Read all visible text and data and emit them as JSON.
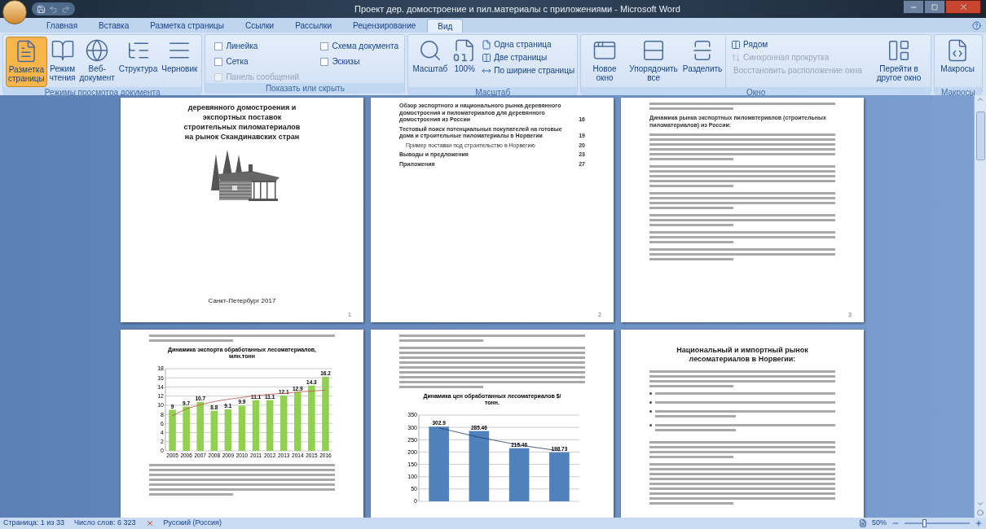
{
  "window": {
    "title": "Проект дер. домостроение и пил.материалы с приложениями - Microsoft Word"
  },
  "tabs": [
    {
      "label": "Главная",
      "selected": false
    },
    {
      "label": "Вставка",
      "selected": false
    },
    {
      "label": "Разметка страницы",
      "selected": false
    },
    {
      "label": "Ссылки",
      "selected": false
    },
    {
      "label": "Рассылки",
      "selected": false
    },
    {
      "label": "Рецензирование",
      "selected": false
    },
    {
      "label": "Вид",
      "selected": true
    }
  ],
  "ribbon": {
    "groups": [
      {
        "label": "Режимы просмотра документа",
        "kind": "views",
        "items": [
          {
            "label": "Разметка страницы",
            "selected": true
          },
          {
            "label": "Режим чтения",
            "selected": false
          },
          {
            "label": "Веб-документ",
            "selected": false
          },
          {
            "label": "Структура",
            "selected": false
          },
          {
            "label": "Черновик",
            "selected": false
          }
        ]
      },
      {
        "label": "Показать или скрыть",
        "kind": "checks",
        "items": [
          {
            "label": "Линейка",
            "checked": false,
            "disabled": false
          },
          {
            "label": "Сетка",
            "checked": false,
            "disabled": false
          },
          {
            "label": "Панель сообщений",
            "checked": false,
            "disabled": true
          },
          {
            "label": "Схема документа",
            "checked": false,
            "disabled": false
          },
          {
            "label": "Эскизы",
            "checked": false,
            "disabled": false
          }
        ]
      },
      {
        "label": "Масштаб",
        "kind": "zoom",
        "items": [
          {
            "label": "Масштаб",
            "disabled": false
          },
          {
            "label": "100%",
            "disabled": false
          },
          {
            "label": "Одна страница",
            "disabled": false
          },
          {
            "label": "Две страницы",
            "disabled": false
          },
          {
            "label": "По ширине страницы",
            "disabled": false
          }
        ]
      },
      {
        "label": "Окно",
        "kind": "window",
        "items": [
          {
            "label": "Новое окно",
            "disabled": false
          },
          {
            "label": "Упорядочить все",
            "disabled": false
          },
          {
            "label": "Разделить",
            "disabled": false
          },
          {
            "label": "Рядом",
            "disabled": false
          },
          {
            "label": "Синхронная прокрутка",
            "disabled": true
          },
          {
            "label": "Восстановить расположение окна",
            "disabled": true
          },
          {
            "label": "Перейти в другое окно",
            "disabled": false
          }
        ]
      },
      {
        "label": "Макросы",
        "kind": "macros",
        "items": [
          {
            "label": "Макросы",
            "disabled": false
          }
        ]
      }
    ]
  },
  "pages": [
    {
      "kind": "title",
      "title": "деревянного домостроения и экспортных поставок строительных пиломатериалов на рынок Скандинавских стран",
      "city": "Санкт-Петербург 2017",
      "number": "1"
    },
    {
      "kind": "toc",
      "entries": [
        {
          "text": "Обзор экспортного и национального рынка деревянного домостроения и пиломатериалов для деревянного домостроения из России",
          "page": "16",
          "indented": false
        },
        {
          "text": "Тестовый поиск потенциальных покупателей на готовые дома и строительные пиломатериалы в Норвегии",
          "page": "19",
          "indented": false
        },
        {
          "text": "Пример поставки под строительство в Норвегию",
          "page": "20",
          "indented": true
        },
        {
          "text": "Выводы и предложения",
          "page": "23",
          "indented": false
        },
        {
          "text": "Приложения",
          "page": "27",
          "indented": false
        }
      ],
      "number": "2"
    },
    {
      "kind": "text",
      "blocks": [
        {
          "kind": "text_lines"
        },
        {
          "kind": "heading",
          "text": "Динамика рынка экспортных пиломатериалов (строительных пиломатериалов) из России:"
        },
        {
          "kind": "text_lines"
        },
        {
          "kind": "text_lines"
        },
        {
          "kind": "text_lines"
        },
        {
          "kind": "text_lines"
        },
        {
          "kind": "text_lines"
        },
        {
          "kind": "text_lines"
        }
      ],
      "number": "3"
    },
    {
      "kind": "text",
      "blocks": [
        {
          "kind": "text_lines"
        },
        {
          "kind": "chart",
          "chart_data": {
            "type": "bar",
            "title": "Динамика экспорта обработанных лесоматериалов, млн.тонн",
            "categories": [
              "2005",
              "2006",
              "2007",
              "2008",
              "2009",
              "2010",
              "2011",
              "2012",
              "2013",
              "2014",
              "2015",
              "2016"
            ],
            "series": [
              {
                "color": "#92d050",
                "values": [
                  9,
                  9.7,
                  10.7,
                  8.8,
                  9.1,
                  9.9,
                  11.1,
                  11.1,
                  12.1,
                  12.9,
                  14.3,
                  16.2
                ]
              },
              {
                "type": "line",
                "color": "#c0504d",
                "values": [
                  7.7,
                  9.2,
                  10.1,
                  10.8,
                  11.3,
                  11.7,
                  12.1,
                  12.4,
                  12.6,
                  12.9,
                  13.1,
                  13.3
                ]
              }
            ],
            "ylim": [
              0,
              18
            ],
            "yticks": [
              0,
              2,
              4,
              6,
              8,
              10,
              12,
              14,
              16,
              18
            ],
            "grid": true,
            "value_labels": [
              [
                "9",
                "9.7",
                "10.7",
                "8.8",
                "9.1",
                "9.9",
                "11.1",
                "11.1",
                "12.1",
                "12.9",
                "14.3",
                "16.2"
              ],
              [
                null,
                null,
                null,
                null,
                null,
                null,
                null,
                null,
                null,
                null,
                null,
                null
              ]
            ]
          }
        },
        {
          "kind": "text_lines"
        }
      ]
    },
    {
      "kind": "text",
      "blocks": [
        {
          "kind": "text_lines"
        },
        {
          "kind": "text_lines"
        },
        {
          "kind": "chart",
          "chart_data": {
            "type": "bar",
            "title": "Динамика цен обработанных лесоматериалов $/тонн.",
            "series": [
              {
                "color": "#4f81bd",
                "values": [
                  302.9,
                  285.46,
                  215.46,
                  198.73
                ]
              },
              {
                "type": "line",
                "color": "#1f3864",
                "values": [
                  298,
                  260,
                  228,
                  205
                ]
              }
            ],
            "ylim": [
              0,
              350
            ],
            "yticks": [
              0,
              50,
              100,
              150,
              200,
              250,
              300,
              350
            ],
            "grid": true,
            "value_labels": [
              [
                "302.9",
                "285.46",
                "215.46",
                "198.73"
              ],
              [
                null,
                null,
                null,
                null
              ]
            ]
          }
        }
      ]
    },
    {
      "kind": "text",
      "blocks": [
        {
          "kind": "title",
          "text": "Национальный и импортный рынок лесоматериалов в Норвегии:"
        },
        {
          "kind": "text_lines"
        },
        {
          "kind": "bullet_lines"
        },
        {
          "kind": "text_lines"
        },
        {
          "kind": "text_lines"
        }
      ]
    }
  ],
  "status_bar": {
    "page": "Страница: 1 из 33",
    "words": "Число слов: 6 323",
    "language": "Русский (Россия)",
    "zoom": "50%",
    "zoom_level": {
      "level": 0.3
    }
  }
}
